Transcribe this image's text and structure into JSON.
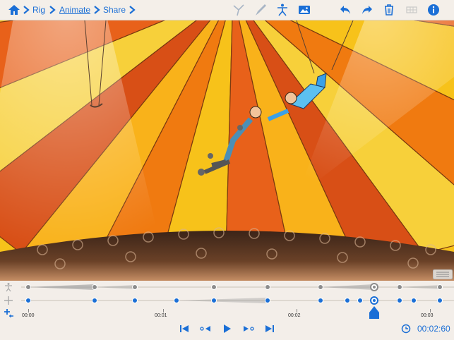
{
  "breadcrumb": {
    "rig": "Rig",
    "animate": "Animate",
    "share": "Share"
  },
  "toolbar": {
    "icons": [
      "home-icon",
      "bone-select-icon",
      "brush-icon",
      "stick-figure-icon",
      "image-icon",
      "undo-icon",
      "redo-icon",
      "trash-icon",
      "grid-icon",
      "info-icon"
    ]
  },
  "timeline": {
    "labels": [
      "00:00",
      "00:01",
      "00:02",
      "00:03"
    ],
    "current_time": "00:02:60"
  },
  "colors": {
    "accent": "#1b6fd6",
    "tent_orange": "#f07a10",
    "tent_yellow": "#f7c21a",
    "tent_red": "#d84f16"
  }
}
